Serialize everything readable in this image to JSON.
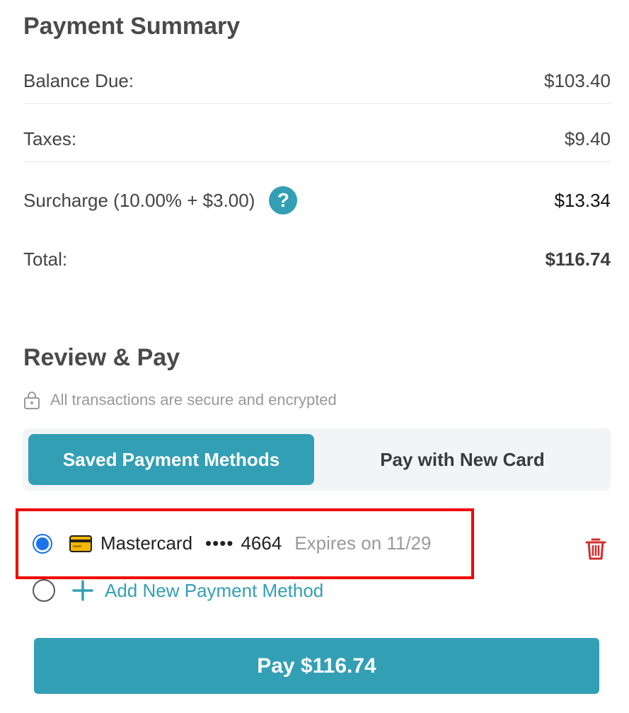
{
  "summary": {
    "title": "Payment Summary",
    "balance_label": "Balance Due:",
    "balance_value": "$103.40",
    "taxes_label": "Taxes:",
    "taxes_value": "$9.40",
    "surcharge_label": "Surcharge (10.00% + $3.00)",
    "surcharge_help": "?",
    "surcharge_value": "$13.34",
    "total_label": "Total:",
    "total_value": "$116.74"
  },
  "review": {
    "title": "Review & Pay",
    "secure_text": "All transactions are secure and encrypted",
    "tabs": [
      {
        "label": "Saved Payment Methods",
        "active": true
      },
      {
        "label": "Pay with New Card",
        "active": false
      }
    ],
    "saved_method": {
      "brand": "Mastercard",
      "masked": "••••",
      "last4": "4664",
      "expires": "Expires on 11/29",
      "selected": true
    },
    "add_method_label": "Add New Payment Method",
    "pay_button_label": "Pay $116.74"
  },
  "colors": {
    "accent": "#339fb5",
    "radio_selected": "#1a73e8",
    "delete": "#d32f2f",
    "highlight": "#f20000",
    "card_icon": "#f5b800"
  },
  "icons": {
    "help": "question-circle-icon",
    "secure": "lock-icon",
    "card": "credit-card-icon",
    "delete": "trash-icon",
    "add": "plus-icon"
  }
}
